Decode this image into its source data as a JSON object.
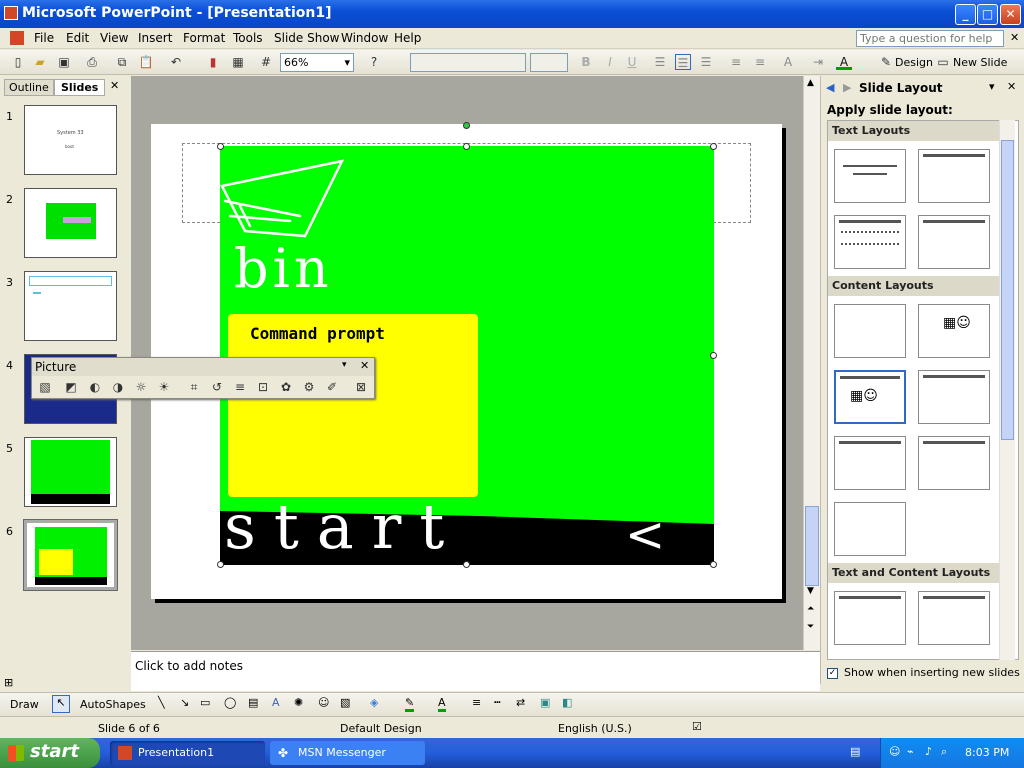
{
  "window": {
    "title": "Microsoft PowerPoint - [Presentation1]",
    "minimize": "_",
    "maximize": "□",
    "close": "✕"
  },
  "menu": [
    "File",
    "Edit",
    "View",
    "Insert",
    "Format",
    "Tools",
    "Slide Show",
    "Window",
    "Help"
  ],
  "help_box": {
    "placeholder": "Type a question for help"
  },
  "toolbar": {
    "zoom": "66%",
    "design_label": "Design",
    "new_slide_label": "New Slide"
  },
  "left_pane": {
    "tabs": [
      "Outline",
      "Slides"
    ],
    "close": "✕",
    "slides": [
      {
        "num": "1",
        "title": "System 33",
        "subtitle": "boot"
      },
      {
        "num": "2"
      },
      {
        "num": "3"
      },
      {
        "num": "4"
      },
      {
        "num": "5"
      },
      {
        "num": "6"
      }
    ]
  },
  "slide": {
    "caption": "Command prompt",
    "drawing_texts": [
      "bin",
      "start",
      "<"
    ]
  },
  "notes": {
    "placeholder": "Click to add notes"
  },
  "picture_toolbar": {
    "title": "Picture",
    "close": "✕"
  },
  "task_pane": {
    "title": "Slide Layout",
    "apply_label": "Apply slide layout:",
    "sections": [
      "Text Layouts",
      "Content Layouts",
      "Text and Content Layouts"
    ],
    "checkbox_label": "Show when inserting new slides"
  },
  "draw_toolbar": {
    "draw_label": "Draw",
    "autoshapes_label": "AutoShapes"
  },
  "status": {
    "slide_pos": "Slide 6 of 6",
    "design": "Default Design",
    "language": "English (U.S.)"
  },
  "taskbar": {
    "start": "start",
    "items": [
      "Presentation1",
      "MSN Messenger"
    ],
    "clock": "8:03 PM"
  },
  "colors": {
    "slide_green": "#00ff00",
    "slide_yellow": "#ffff00",
    "xp_blue": "#245edb",
    "start_green": "#3c8f3c"
  }
}
